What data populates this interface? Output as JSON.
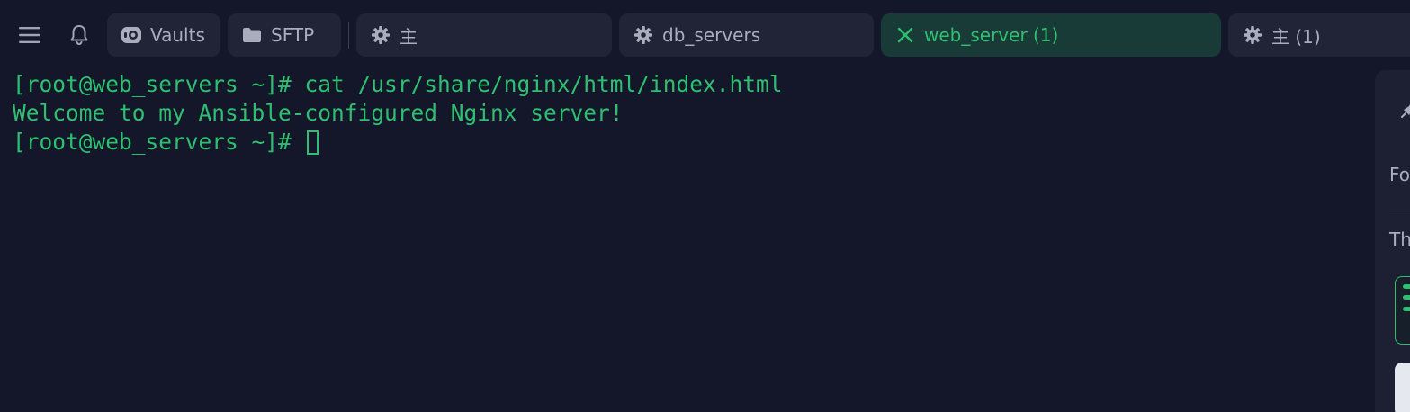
{
  "topbar": {
    "menu_icon": "hamburger-menu-icon",
    "notification_icon": "bell-icon",
    "tabs": [
      {
        "label": "Vaults",
        "icon": "vault-icon",
        "active": false
      },
      {
        "label": "SFTP",
        "icon": "folder-icon",
        "active": false
      },
      {
        "label": "主",
        "icon": "gear-icon",
        "active": false
      },
      {
        "label": "db_servers",
        "icon": "gear-icon",
        "active": false
      },
      {
        "label": "web_server (1)",
        "icon": "close-icon",
        "active": true
      },
      {
        "label": "主 (1)",
        "icon": "gear-icon",
        "active": false
      }
    ]
  },
  "terminal": {
    "lines": [
      "[root@web_servers ~]# cat /usr/share/nginx/html/index.html",
      "Welcome to my Ansible-configured Nginx server!",
      "[root@web_servers ~]# "
    ]
  },
  "sidepanel": {
    "text1": "Fo",
    "text2": "Th"
  },
  "colors": {
    "background": "#141729",
    "tab": "#212436",
    "active_tab": "#183b37",
    "accent": "#2fbf71"
  }
}
